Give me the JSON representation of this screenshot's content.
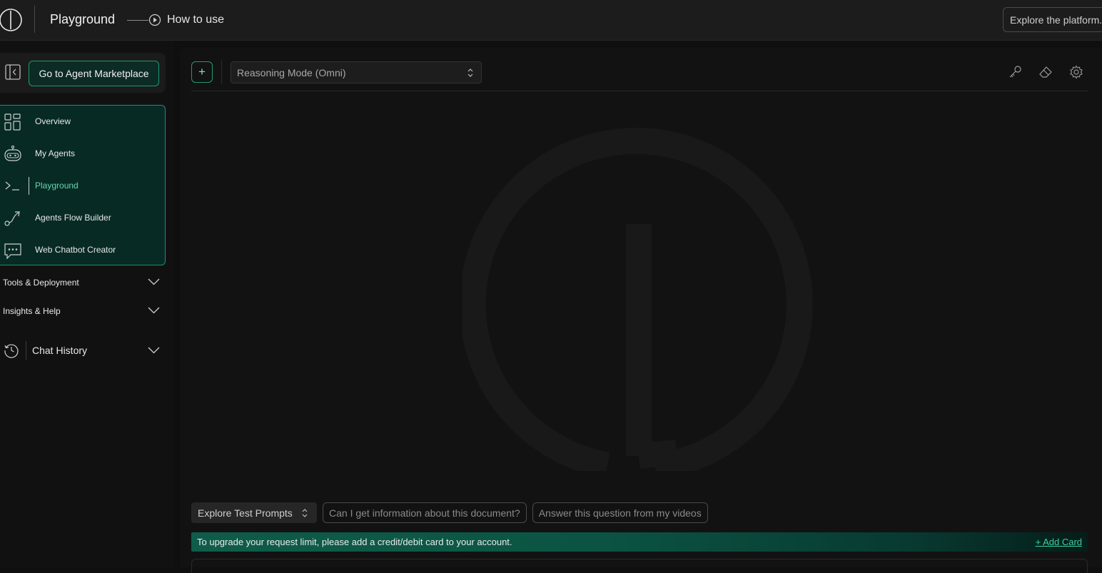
{
  "header": {
    "title": "Playground",
    "how_to_use": "How to use",
    "explore_button": "Explore the platform."
  },
  "sidebar": {
    "marketplace_button": "Go to Agent Marketplace",
    "nav_items": [
      {
        "label": "Overview",
        "icon": "grid-icon"
      },
      {
        "label": "My Agents",
        "icon": "robot-icon"
      },
      {
        "label": "Playground",
        "icon": "terminal-icon",
        "active": true
      },
      {
        "label": "Agents Flow Builder",
        "icon": "flow-icon"
      },
      {
        "label": "Web Chatbot Creator",
        "icon": "chat-bubble-icon"
      }
    ],
    "groups": [
      {
        "label": "Tools & Deployment"
      },
      {
        "label": "Insights & Help"
      }
    ],
    "history_label": "Chat History"
  },
  "main": {
    "mode_select": "Reasoning Mode (Omni)",
    "prompt_select": "Explore Test Prompts",
    "prompt_chips": [
      "Can I get information about this document?",
      "Answer this question from my videos"
    ],
    "banner_text": "To upgrade your request limit, please add a credit/debit card to your account.",
    "add_card": "+ Add Card"
  },
  "colors": {
    "accent": "#1f9a72",
    "nav_bg": "#072a24",
    "active_text": "#64d6ad",
    "link": "#3fd0a0"
  }
}
